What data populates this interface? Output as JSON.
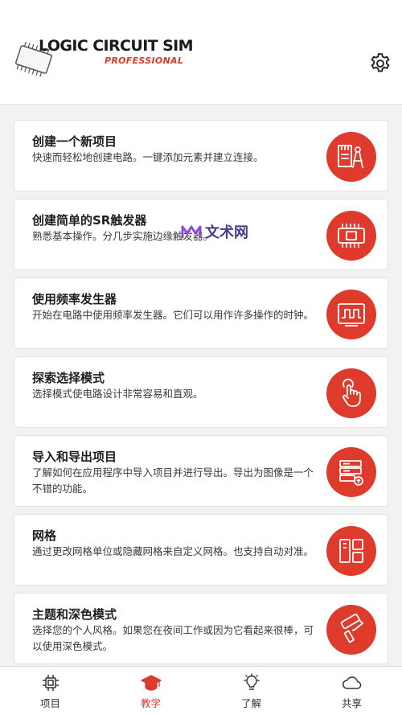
{
  "header": {
    "logo_title": "LOGIC CIRCUIT SIM",
    "logo_subtitle": "PROFESSIONAL",
    "settings_icon": "gear-icon"
  },
  "cards": [
    {
      "title": "创建一个新项目",
      "desc": "快速而轻松地创建电路。一键添加元素并建立连接。",
      "icon": "drafting-tools-icon"
    },
    {
      "title": "创建简单的SR触发器",
      "desc": "熟悉基本操作。分几步实施边缘触发器。",
      "icon": "chip-icon"
    },
    {
      "title": "使用频率发生器",
      "desc": "开始在电路中使用频率发生器。它们可以用作许多操作的时钟。",
      "icon": "oscilloscope-icon"
    },
    {
      "title": "探索选择模式",
      "desc": "选择模式使电路设计非常容易和直观。",
      "icon": "tap-hand-icon"
    },
    {
      "title": "导入和导出项目",
      "desc": "了解如何在应用程序中导入项目并进行导出。导出为图像是一个不错的功能。",
      "icon": "server-upload-icon"
    },
    {
      "title": "网格",
      "desc": "通过更改网格单位或隐藏网格来自定义网格。也支持自动对准。",
      "icon": "grid-layout-icon"
    },
    {
      "title": "主题和深色模式",
      "desc": "选择您的个人风格。如果您在夜间工作或因为它看起来很棒，可以使用深色模式。",
      "icon": "paint-roller-icon"
    }
  ],
  "watermark": {
    "text": "文术网"
  },
  "nav": [
    {
      "label": "项目",
      "icon": "chip-icon",
      "active": false
    },
    {
      "label": "教学",
      "icon": "graduation-cap-icon",
      "active": true
    },
    {
      "label": "了解",
      "icon": "lightbulb-icon",
      "active": false
    },
    {
      "label": "共享",
      "icon": "cloud-icon",
      "active": false
    }
  ],
  "colors": {
    "accent": "#de3b2c",
    "background": "#f2f2f2",
    "card": "#ffffff"
  }
}
